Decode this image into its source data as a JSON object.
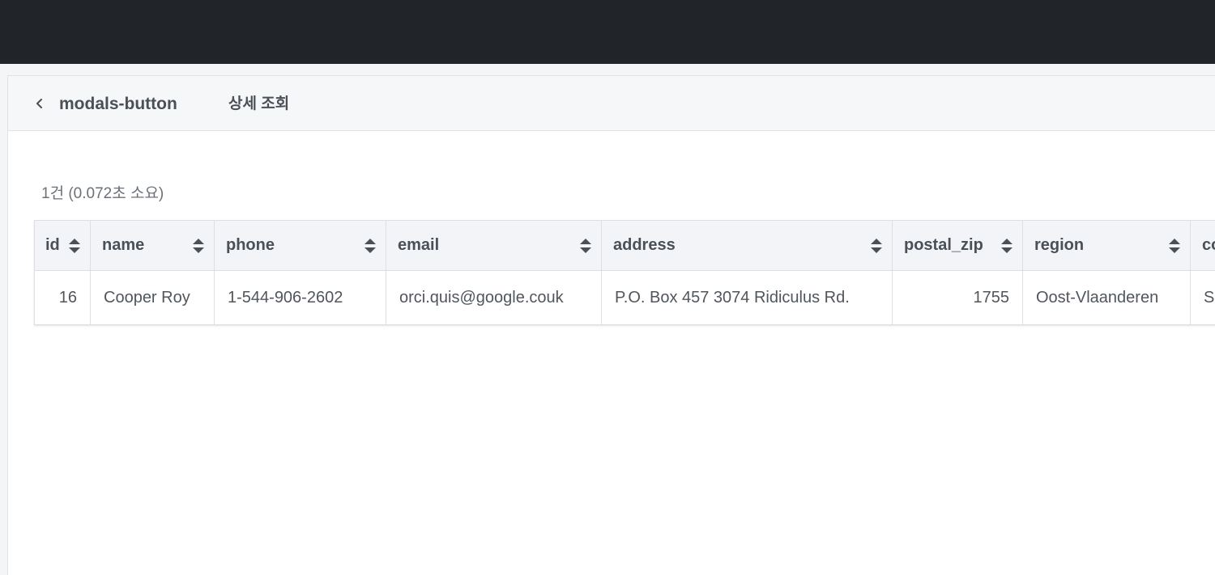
{
  "header": {
    "title": "modals-button",
    "subtitle": "상세 조회"
  },
  "result": {
    "summary": "1건 (0.072초 소요)"
  },
  "table": {
    "columns": [
      "id",
      "name",
      "phone",
      "email",
      "address",
      "postal_zip",
      "region",
      "co"
    ],
    "rows": [
      [
        "16",
        "Cooper Roy",
        "1-544-906-2602",
        "orci.quis@google.couk",
        "P.O. Box 457 3074 Ridiculus Rd.",
        "1755",
        "Oost-Vlaanderen",
        "S"
      ]
    ]
  },
  "icons": {
    "back": "chevron-left-icon",
    "sort": "sort-icon"
  },
  "colors": {
    "topbar": "#212429",
    "header_bg": "#f6f7f9",
    "table_header_bg": "#f3f4f7",
    "border": "#dcdfe3"
  }
}
